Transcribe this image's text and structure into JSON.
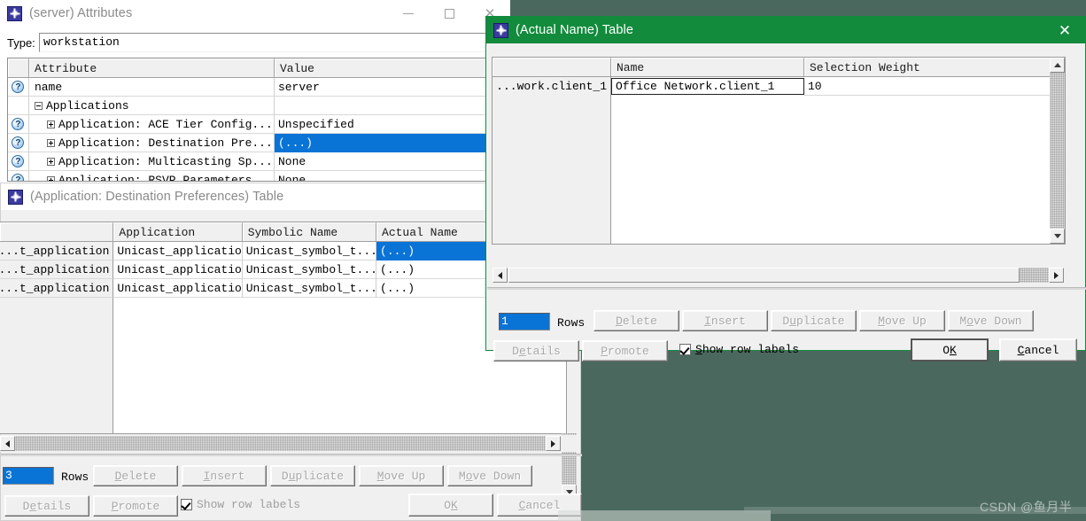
{
  "desktop": {
    "background": "#4a685e",
    "watermark": "CSDN @鱼月半"
  },
  "window_attributes": {
    "title": "(server) Attributes",
    "icon": "opnet-star-icon",
    "controls": {
      "minimize": "minimize-icon",
      "maximize": "maximize-icon",
      "close": "close-icon"
    },
    "type_label": "Type:",
    "type_value": "workstation",
    "columns": [
      "Attribute",
      "Value"
    ],
    "rows": [
      {
        "help": true,
        "indent": 0,
        "expander": "",
        "attribute": "name",
        "value": "server",
        "selected": false
      },
      {
        "help": false,
        "indent": 0,
        "expander": "minus",
        "attribute": "Applications",
        "value": "",
        "selected": false
      },
      {
        "help": true,
        "indent": 1,
        "expander": "plus",
        "attribute": "Application: ACE Tier Config...",
        "value": "Unspecified",
        "selected": false
      },
      {
        "help": true,
        "indent": 1,
        "expander": "plus",
        "attribute": "Application: Destination Pre...",
        "value": "(...)",
        "selected": true
      },
      {
        "help": true,
        "indent": 1,
        "expander": "plus",
        "attribute": "Application: Multicasting Sp...",
        "value": "None",
        "selected": false
      },
      {
        "help": true,
        "indent": 1,
        "expander": "plus",
        "attribute": "Application: RSVP Parameters",
        "value": "None",
        "selected": false
      }
    ]
  },
  "window_destpref": {
    "title": "(Application: Destination Preferences) Table",
    "icon": "opnet-star-icon",
    "columns": [
      "",
      "Application",
      "Symbolic Name",
      "Actual Name"
    ],
    "rows": [
      {
        "row_label": "...t_application",
        "application": "Unicast_application",
        "symbolic_name": "Unicast_symbol_t...",
        "actual_name": "(...)",
        "selected": true
      },
      {
        "row_label": "...t_application",
        "application": "Unicast_application",
        "symbolic_name": "Unicast_symbol_t...",
        "actual_name": "(...)",
        "selected": false
      },
      {
        "row_label": "...t_application",
        "application": "Unicast_application",
        "symbolic_name": "Unicast_symbol_t...",
        "actual_name": "(...)",
        "selected": false
      }
    ],
    "rows_value": "3",
    "rows_label": "Rows",
    "buttons": {
      "delete": "Delete",
      "insert": "Insert",
      "duplicate": "Duplicate",
      "move_up": "Move Up",
      "move_down": "Move Down",
      "details": "Details",
      "promote": "Promote",
      "ok": "OK",
      "cancel": "Cancel"
    },
    "show_row_labels": "Show row labels",
    "show_row_labels_checked": true
  },
  "window_actualname": {
    "title": "(Actual Name) Table",
    "icon": "opnet-star-icon",
    "active": true,
    "accent": "#128b3c",
    "close": "close-icon",
    "columns": [
      "",
      "Name",
      "Selection Weight"
    ],
    "rows": [
      {
        "row_label": "...work.client_1",
        "name": "Office Network.client_1",
        "selection_weight": "10",
        "editing": true
      }
    ],
    "rows_value": "1",
    "rows_label": "Rows",
    "buttons": {
      "delete": "Delete",
      "insert": "Insert",
      "duplicate": "Duplicate",
      "move_up": "Move Up",
      "move_down": "Move Down",
      "details": "Details",
      "promote": "Promote",
      "ok": "OK",
      "cancel": "Cancel"
    },
    "show_row_labels": "Show row labels",
    "show_row_labels_checked": true
  }
}
